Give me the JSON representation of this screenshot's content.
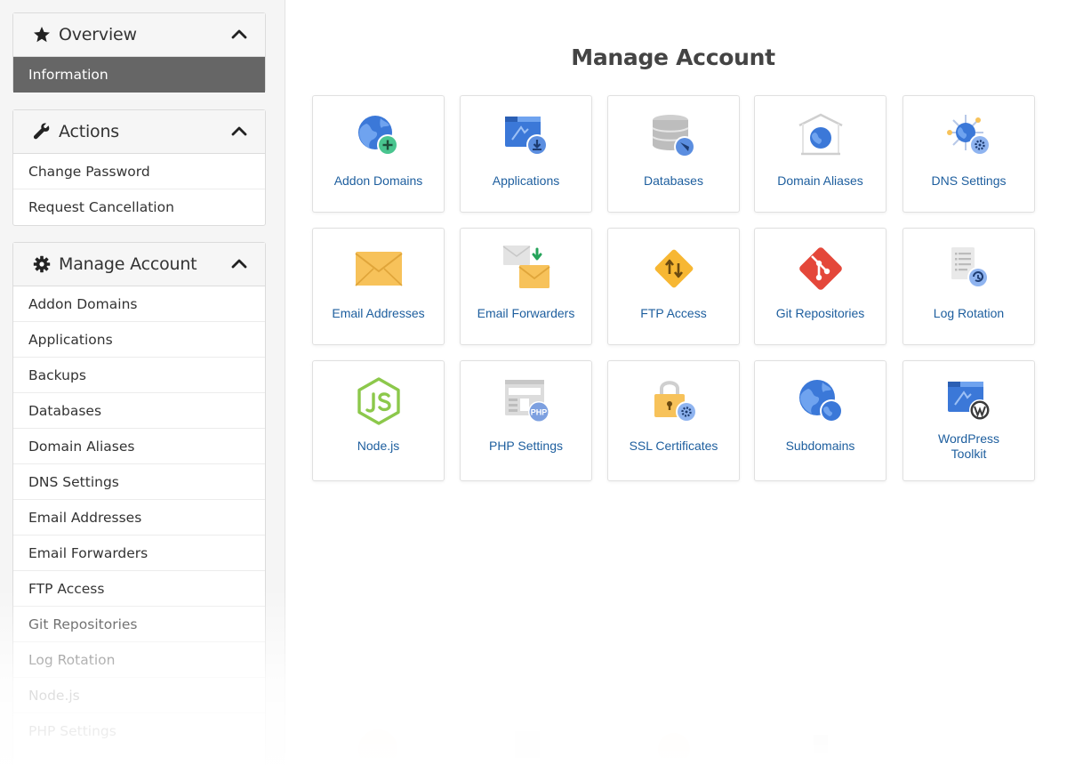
{
  "sidebar": {
    "overview": {
      "title": "Overview",
      "icon": "star-icon",
      "items": [
        {
          "label": "Information",
          "active": true
        }
      ]
    },
    "actions": {
      "title": "Actions",
      "icon": "wrench-icon",
      "items": [
        {
          "label": "Change Password"
        },
        {
          "label": "Request Cancellation"
        }
      ]
    },
    "manage": {
      "title": "Manage Account",
      "icon": "gear-icon",
      "items": [
        {
          "label": "Addon Domains"
        },
        {
          "label": "Applications"
        },
        {
          "label": "Backups"
        },
        {
          "label": "Databases"
        },
        {
          "label": "Domain Aliases"
        },
        {
          "label": "DNS Settings"
        },
        {
          "label": "Email Addresses"
        },
        {
          "label": "Email Forwarders"
        },
        {
          "label": "FTP Access"
        },
        {
          "label": "Git Repositories"
        },
        {
          "label": "Log Rotation"
        },
        {
          "label": "Node.js"
        },
        {
          "label": "PHP Settings"
        }
      ]
    }
  },
  "main": {
    "title": "Manage Account",
    "tiles": [
      {
        "label": "Addon Domains",
        "icon": "globe-add-icon"
      },
      {
        "label": "Applications",
        "icon": "app-install-icon"
      },
      {
        "label": "Databases",
        "icon": "database-icon"
      },
      {
        "label": "Domain Aliases",
        "icon": "globe-house-icon"
      },
      {
        "label": "DNS Settings",
        "icon": "dns-gear-icon"
      },
      {
        "label": "Email Addresses",
        "icon": "envelope-icon"
      },
      {
        "label": "Email Forwarders",
        "icon": "envelope-forward-icon"
      },
      {
        "label": "FTP Access",
        "icon": "ftp-diamond-icon"
      },
      {
        "label": "Git Repositories",
        "icon": "git-icon"
      },
      {
        "label": "Log Rotation",
        "icon": "log-rotate-icon"
      },
      {
        "label": "Node.js",
        "icon": "nodejs-icon"
      },
      {
        "label": "PHP Settings",
        "icon": "php-icon"
      },
      {
        "label": "SSL Certificates",
        "icon": "padlock-gear-icon"
      },
      {
        "label": "Subdomains",
        "icon": "globes-icon"
      },
      {
        "label": "WordPress Toolkit",
        "icon": "wordpress-icon"
      }
    ]
  },
  "colors": {
    "link": "#1d5e9e",
    "active_bg": "#666666",
    "icon_blue": "#3b78d8",
    "icon_yellow": "#f7c25a",
    "git_red": "#e4473a",
    "node_green": "#8cc84b"
  }
}
